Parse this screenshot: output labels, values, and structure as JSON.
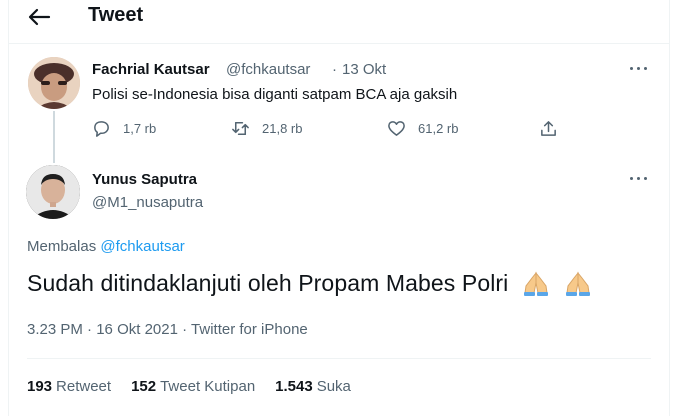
{
  "header": {
    "title": "Tweet"
  },
  "parent_tweet": {
    "name": "Fachrial Kautsar",
    "handle": "@fchkautsar",
    "separator": "·",
    "date": "13 Okt",
    "text": "Polisi se-Indonesia bisa diganti satpam BCA aja gaksih",
    "actions": {
      "replies": "1,7 rb",
      "retweets": "21,8 rb",
      "likes": "61,2 rb"
    }
  },
  "main_tweet": {
    "name": "Yunus Saputra",
    "handle": "@M1_nusaputra",
    "replying_label": "Membalas",
    "replying_to": "@fchkautsar",
    "text": "Sudah ditindaklanjuti oleh Propam Mabes Polri",
    "time": "3.23 PM",
    "date": "16 Okt 2021",
    "source": "Twitter for iPhone",
    "meta_sep": "·",
    "stats": [
      {
        "count": "193",
        "label": "Retweet"
      },
      {
        "count": "152",
        "label": "Tweet Kutipan"
      },
      {
        "count": "1.543",
        "label": "Suka"
      }
    ]
  },
  "colors": {
    "link": "#1d9bf0",
    "secondary": "#536471",
    "border": "#eff3f4"
  }
}
